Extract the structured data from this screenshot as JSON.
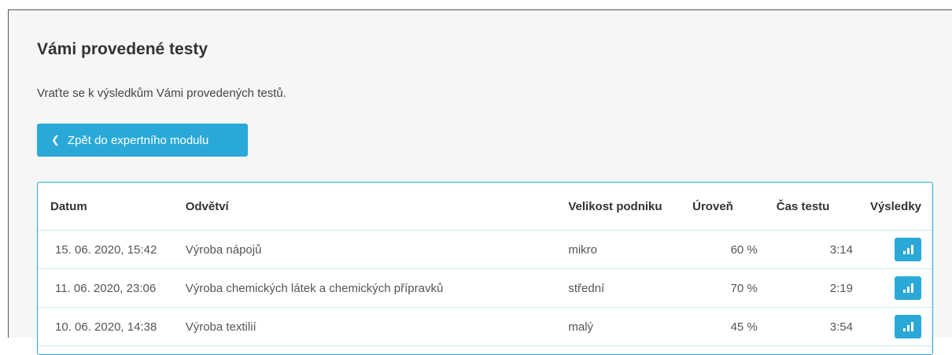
{
  "page": {
    "title": "Vámi provedené testy",
    "subtitle": "Vraťte se k výsledkům Vámi provedených testů.",
    "back_button": "Zpět do expertního modulu"
  },
  "table": {
    "headers": {
      "date": "Datum",
      "sector": "Odvětví",
      "size": "Velikost podniku",
      "level": "Úroveň",
      "time": "Čas testu",
      "results": "Výsledky"
    },
    "rows": [
      {
        "date": "15. 06. 2020, 15:42",
        "sector": "Výroba nápojů",
        "size": "mikro",
        "level": "60 %",
        "time": "3:14"
      },
      {
        "date": "11. 06. 2020, 23:06",
        "sector": "Výroba chemických látek a chemických přípravků",
        "size": "střední",
        "level": "70 %",
        "time": "2:19"
      },
      {
        "date": "10. 06. 2020, 14:38",
        "sector": "Výroba textilií",
        "size": "malý",
        "level": "45 %",
        "time": "3:54"
      }
    ]
  },
  "icons": {
    "back": "chevron-left-icon",
    "results": "bar-chart-icon"
  },
  "colors": {
    "accent": "#2aa9d9",
    "background": "#f6f6f6"
  }
}
